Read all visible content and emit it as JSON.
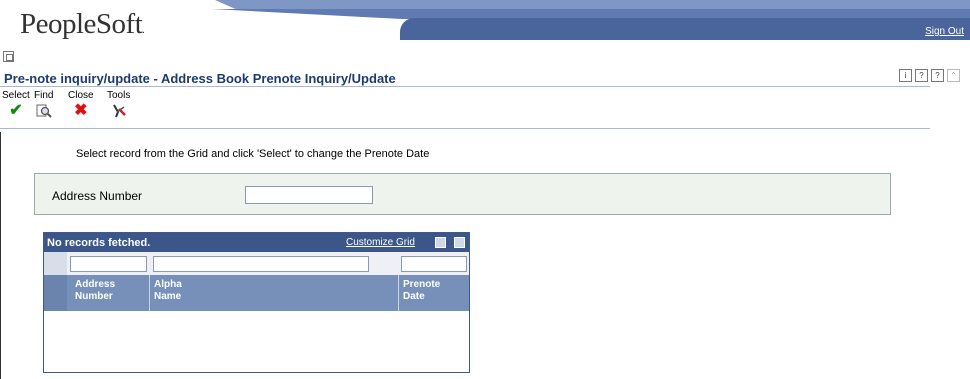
{
  "header": {
    "logo": "PeopleSoft",
    "logo_mark": ".",
    "sign_out": "Sign Out"
  },
  "page": {
    "title": "Pre-note inquiry/update - Address Book Prenote Inquiry/Update",
    "help_icons": [
      "i",
      "?",
      "?"
    ]
  },
  "toolbar": {
    "items": [
      {
        "label": "Select",
        "icon": "check-icon"
      },
      {
        "label": "Find",
        "icon": "find-icon"
      },
      {
        "label": "Close",
        "icon": "close-icon"
      },
      {
        "label": "Tools",
        "icon": "tools-icon"
      }
    ]
  },
  "instruction": "Select record from the Grid and click 'Select' to change the Prenote Date",
  "filter": {
    "address_number_label": "Address Number",
    "address_number_value": ""
  },
  "grid": {
    "message": "No records fetched.",
    "customize_label": "Customize Grid",
    "columns": [
      {
        "line1": "Address",
        "line2": "Number"
      },
      {
        "line1": "Alpha",
        "line2": "Name"
      },
      {
        "line1": "Prenote",
        "line2": "Date"
      }
    ],
    "rows": []
  },
  "colors": {
    "brand_band": "#49659c",
    "title_text": "#1c3b6f",
    "grid_header": "#3b5689",
    "column_header": "#7690ba"
  }
}
